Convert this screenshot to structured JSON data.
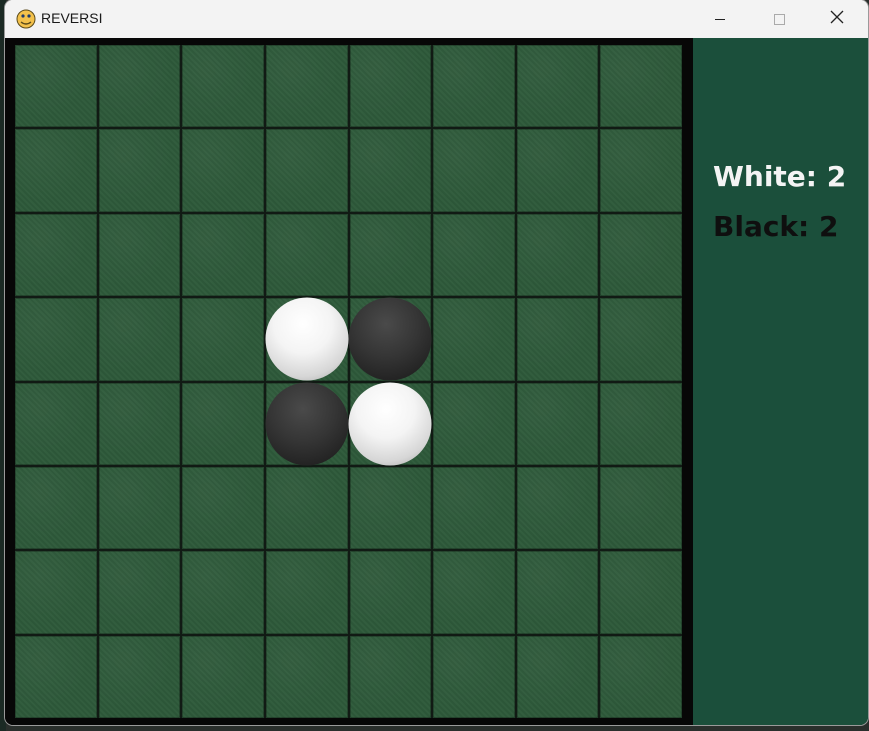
{
  "window": {
    "title": "REVERSI",
    "icon": "pygame-snake-icon",
    "controls": [
      "minimize",
      "maximize",
      "close"
    ]
  },
  "board": {
    "rows": 8,
    "cols": 8,
    "cell_color": "#2e5a3a",
    "pieces": [
      {
        "row": 3,
        "col": 3,
        "color": "white"
      },
      {
        "row": 3,
        "col": 4,
        "color": "black"
      },
      {
        "row": 4,
        "col": 3,
        "color": "black"
      },
      {
        "row": 4,
        "col": 4,
        "color": "white"
      }
    ]
  },
  "scoreboard": {
    "white_text": "White: 2",
    "black_text": "Black: 2",
    "background": "#1b4f3b"
  }
}
